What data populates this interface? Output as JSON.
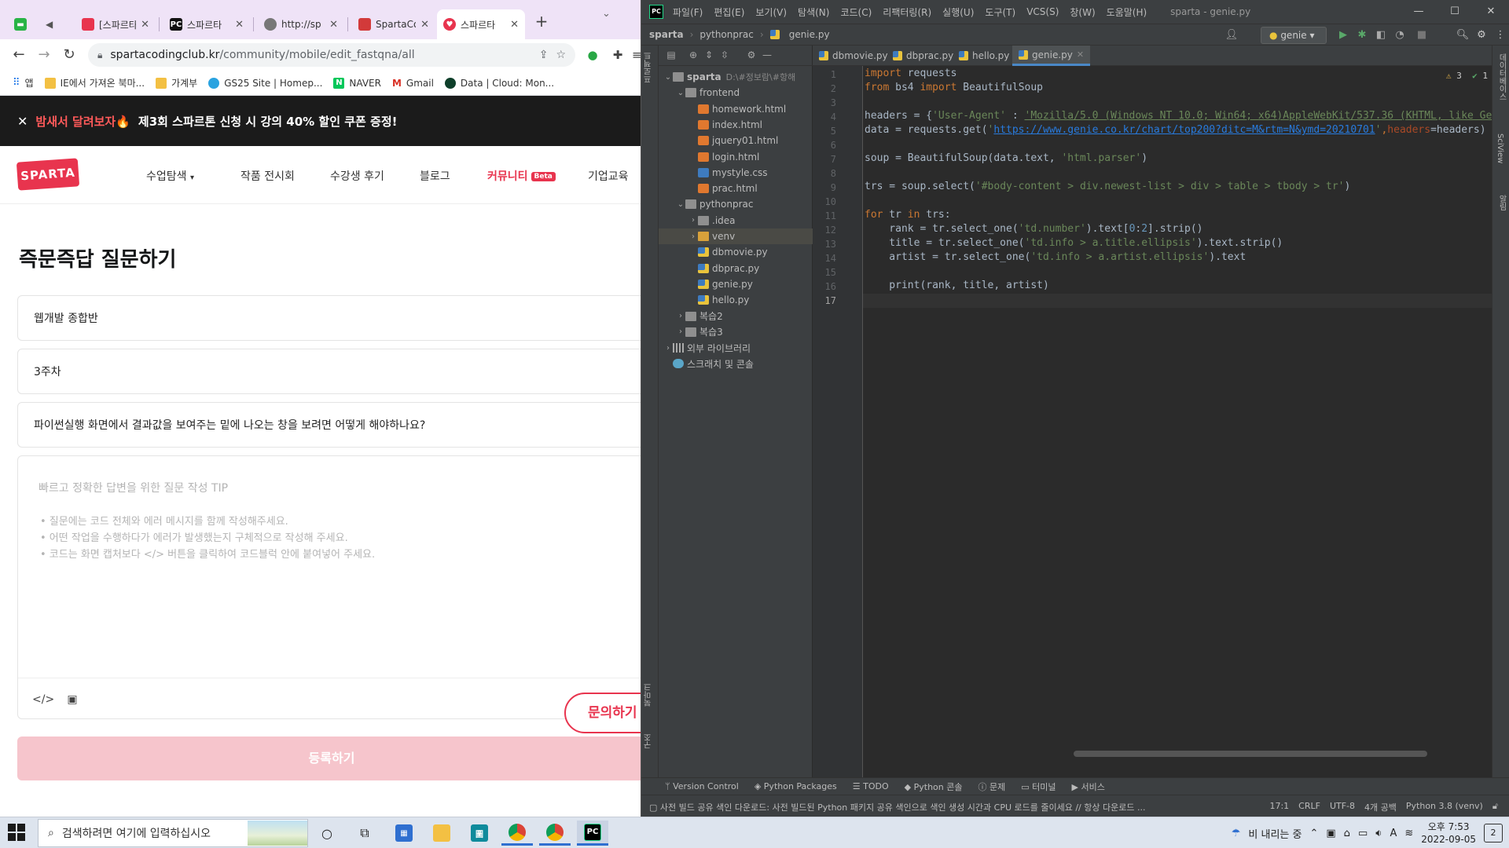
{
  "browser": {
    "tabs": [
      {
        "title": "[스파르타",
        "favicon_color": "#e8344e"
      },
      {
        "title": "스파르타",
        "favicon_color": "#111111"
      },
      {
        "title": "http://sp",
        "favicon_color": "#777777"
      },
      {
        "title": "SpartaCo",
        "favicon_color": "#d23a3a"
      },
      {
        "title": "스파르타",
        "favicon_color": "#e8344e"
      }
    ],
    "address_host": "spartacodingclub.kr",
    "address_path": "/community/mobile/edit_fastqna/all",
    "bookmarks": [
      "앱",
      "IE에서 가져온 북마...",
      "가계부",
      "GS25 Site | Homep...",
      "NAVER",
      "Gmail",
      "Data | Cloud: Mon..."
    ]
  },
  "site": {
    "banner_prefix": "밤새서 달려보자",
    "banner_emoji": "🔥",
    "banner_text": "제3회 스파르톤 신청 시 강의 40% 할인 쿠폰 증정!",
    "logo": "SPARTA",
    "nav": [
      "수업탐색",
      "작품 전시회",
      "수강생 후기",
      "블로그",
      "커뮤니티",
      "기업교육"
    ],
    "beta": "Beta",
    "page_title": "즉문즉답 질문하기",
    "course": "웹개발 종합반",
    "week": "3주차",
    "question_title": "파이썬실행 화면에서 결과값을 보여주는 밑에 나오는 창을 보려면 어떻게 해야하나요?",
    "tip_title": "빠르고 정확한 답변을 위한 질문 작성 TIP",
    "tips": [
      "• 질문에는 코드 전체와 에러 메시지를 함께 작성해주세요.",
      "• 어떤 작업을 수행하다가 에러가 발생했는지 구체적으로 작성해 주세요.",
      "• 코드는 화면 캡처보다 </> 버튼을 클릭하여 코드블럭 안에 붙여넣어 주세요."
    ],
    "code_button": "</>",
    "ask_button": "문의하기",
    "submit_button": "등록하기",
    "accent_color": "#e8344e"
  },
  "ide": {
    "menus": [
      "파일(F)",
      "편집(E)",
      "보기(V)",
      "탐색(N)",
      "코드(C)",
      "리팩터링(R)",
      "실행(U)",
      "도구(T)",
      "VCS(S)",
      "창(W)",
      "도움말(H)"
    ],
    "window_title": "sparta - genie.py",
    "breadcrumb": [
      "sparta",
      "pythonprac",
      "genie.py"
    ],
    "run_config": "genie",
    "left_strip_labels": [
      "프로젝트",
      "북마크",
      "구조"
    ],
    "right_strip_labels": [
      "데이터베이스",
      "SciView",
      "알림"
    ],
    "tree": [
      {
        "label": "sparta",
        "note": "D:\\#정보람\\#항해",
        "depth": 0,
        "arrow": "down",
        "icon": "folder"
      },
      {
        "label": "frontend",
        "depth": 1,
        "arrow": "down",
        "icon": "folder"
      },
      {
        "label": "homework.html",
        "depth": 2,
        "icon": "html"
      },
      {
        "label": "index.html",
        "depth": 2,
        "icon": "html"
      },
      {
        "label": "jquery01.html",
        "depth": 2,
        "icon": "html"
      },
      {
        "label": "login.html",
        "depth": 2,
        "icon": "html"
      },
      {
        "label": "mystyle.css",
        "depth": 2,
        "icon": "css"
      },
      {
        "label": "prac.html",
        "depth": 2,
        "icon": "html"
      },
      {
        "label": "pythonprac",
        "depth": 1,
        "arrow": "down",
        "icon": "folder"
      },
      {
        "label": ".idea",
        "depth": 2,
        "arrow": "right",
        "icon": "folder"
      },
      {
        "label": "venv",
        "depth": 2,
        "arrow": "right",
        "icon": "folder-orange",
        "selected": true
      },
      {
        "label": "dbmovie.py",
        "depth": 2,
        "icon": "py"
      },
      {
        "label": "dbprac.py",
        "depth": 2,
        "icon": "py"
      },
      {
        "label": "genie.py",
        "depth": 2,
        "icon": "py"
      },
      {
        "label": "hello.py",
        "depth": 2,
        "icon": "py"
      },
      {
        "label": "복습2",
        "depth": 1,
        "arrow": "right",
        "icon": "folder"
      },
      {
        "label": "복습3",
        "depth": 1,
        "arrow": "right",
        "icon": "folder"
      },
      {
        "label": "외부 라이브러리",
        "depth": 0,
        "arrow": "right",
        "icon": "lib"
      },
      {
        "label": "스크래치 및 콘솔",
        "depth": 0,
        "icon": "scratch"
      }
    ],
    "editor_tabs": [
      {
        "name": "dbmovie.py",
        "active": false
      },
      {
        "name": "dbprac.py",
        "active": false
      },
      {
        "name": "hello.py",
        "active": false
      },
      {
        "name": "genie.py",
        "active": true
      }
    ],
    "line_numbers": [
      "1",
      "2",
      "3",
      "4",
      "5",
      "6",
      "7",
      "8",
      "9",
      "10",
      "11",
      "12",
      "13",
      "14",
      "15",
      "16",
      "17"
    ],
    "code": {
      "import_kw": "import",
      "requests": " requests",
      "from_kw": "from",
      "bs4": " bs4 ",
      "bs_import": "import",
      "bs_cls": " BeautifulSoup",
      "headers_assign": "headers = {",
      "ua_key": "'User-Agent'",
      "colon": " : ",
      "ua_value": "'Mozilla/5.0 (Windows NT 10.0; Win64; x64)AppleWebKit/537.36 (KHTML, like Ge",
      "data_assign": "data = requests.get(",
      "q1": "'",
      "url": "https://www.genie.co.kr/chart/top200?ditc=M&rtm=N&ymd=20210701",
      "q2": "'",
      "comma": ",",
      "headers_kw": "headers",
      "headers_val": "=headers)",
      "soup_line": "soup = BeautifulSoup(data.text, ",
      "parser": "'html.parser'",
      "close": ")",
      "trs_line": "trs = soup.select(",
      "selector": "'#body-content > div.newest-list > div > table > tbody > tr'",
      "for_kw": "for",
      "tr": " tr ",
      "in_kw": "in",
      "trs": " trs:",
      "rank_a": "    rank = tr.select_one(",
      "rank_sel": "'td.number'",
      "rank_b": ").text[",
      "n0": "0",
      "n_colon": ":",
      "n2": "2",
      "rank_c": "].strip()",
      "title_a": "    title = tr.select_one(",
      "title_sel": "'td.info > a.title.ellipsis'",
      "title_b": ").text.strip()",
      "artist_a": "    artist = tr.select_one(",
      "artist_sel": "'td.info > a.artist.ellipsis'",
      "artist_b": ").text",
      "print_line": "    print(rank, title, artist)"
    },
    "inspections": {
      "warnings": "3",
      "ok": "1"
    },
    "tool_windows": [
      "Version Control",
      "Python Packages",
      "TODO",
      "Python 콘솔",
      "문제",
      "터미널",
      "서비스"
    ],
    "status_message": "사전 빌드 공유 색인 다운로드: 사전 빌드된 Python 패키지 공유 색인으로 색인 생성 시간과 CPU 로드를 줄이세요 // 항상 다운로드 ...",
    "status_right": [
      "17:1",
      "CRLF",
      "UTF-8",
      "4개 공백",
      "Python 3.8 (venv)"
    ]
  },
  "taskbar": {
    "search_placeholder": "검색하려면 여기에 입력하십시오",
    "weather": "비 내리는 중",
    "time": "오후 7:53",
    "date": "2022-09-05",
    "notifications": "2",
    "ime": "A"
  }
}
